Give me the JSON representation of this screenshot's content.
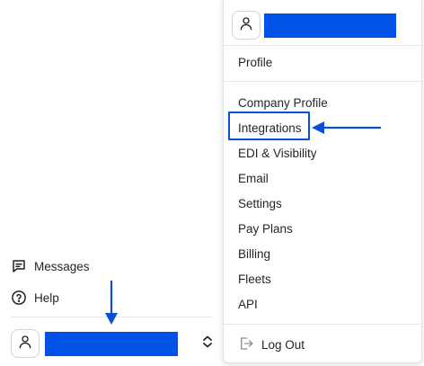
{
  "sidebar": {
    "messages_label": "Messages",
    "help_label": "Help"
  },
  "menu": {
    "items": [
      {
        "label": "Profile"
      },
      {
        "label": "Company Profile"
      },
      {
        "label": "Integrations"
      },
      {
        "label": "EDI & Visibility"
      },
      {
        "label": "Email"
      },
      {
        "label": "Settings"
      },
      {
        "label": "Pay Plans"
      },
      {
        "label": "Billing"
      },
      {
        "label": "Fleets"
      },
      {
        "label": "API"
      }
    ],
    "logout_label": "Log Out"
  },
  "colors": {
    "redaction": "#0052e6",
    "annotation": "#0a4fd6"
  },
  "icons": {
    "messages": "message-square-icon",
    "help": "help-circle-icon",
    "avatar": "user-icon",
    "switcher": "chevron-up-down-icon",
    "logout": "log-out-icon"
  }
}
